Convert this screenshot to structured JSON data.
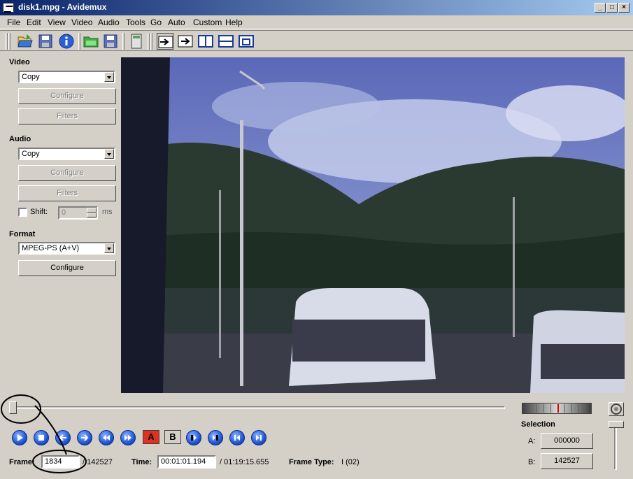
{
  "window": {
    "title": "disk1.mpg - Avidemux"
  },
  "menu": [
    "File",
    "Edit",
    "View",
    "Video",
    "Audio",
    "Tools",
    "Go",
    "Auto",
    "Custom",
    "Help"
  ],
  "video": {
    "label": "Video",
    "codec": "Copy",
    "configure_label": "Configure",
    "filters_label": "Filters"
  },
  "audio": {
    "label": "Audio",
    "codec": "Copy",
    "configure_label": "Configure",
    "filters_label": "Filters",
    "shift_label": "Shift:",
    "shift_value": "0",
    "shift_unit": "ms"
  },
  "format": {
    "label": "Format",
    "container": "MPEG-PS (A+V)",
    "configure_label": "Configure"
  },
  "navigation": {
    "marker_a": "A",
    "marker_b": "B"
  },
  "status": {
    "frame_label": "Frame:",
    "frame_value": "1834",
    "frame_total": "/ 142527",
    "time_label": "Time:",
    "time_value": "00:01:01.194",
    "time_total": "/ 01:19:15.655",
    "frame_type_label": "Frame Type:",
    "frame_type_value": "I (02)",
    "position_fraction": 0.0129
  },
  "selection": {
    "label": "Selection",
    "a_label": "A:",
    "a_value": "000000",
    "b_label": "B:",
    "b_value": "142527"
  },
  "colors": {
    "titlebar": "#0a246a",
    "window_bg": "#d4d0c8",
    "marker_a_bg": "#e03020",
    "jog_marker": "#e00000"
  }
}
